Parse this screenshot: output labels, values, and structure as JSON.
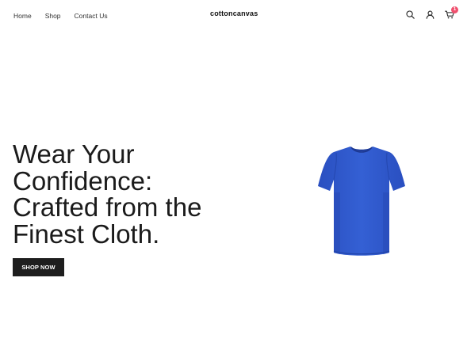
{
  "header": {
    "nav": [
      {
        "label": "Home"
      },
      {
        "label": "Shop"
      },
      {
        "label": "Contact Us"
      }
    ],
    "brand": "cottoncanvas",
    "cart_count": "1",
    "icons": [
      "search-icon",
      "user-icon",
      "cart-icon"
    ]
  },
  "hero": {
    "title_lines": [
      "Wear Your",
      "Confidence:",
      "Crafted from the",
      "Finest Cloth."
    ],
    "cta_label": "SHOP NOW",
    "product_image": "blue-tshirt"
  },
  "colors": {
    "accent": "#1e1e1e",
    "badge": "#f0506e",
    "shirt": "#2e57c9"
  }
}
